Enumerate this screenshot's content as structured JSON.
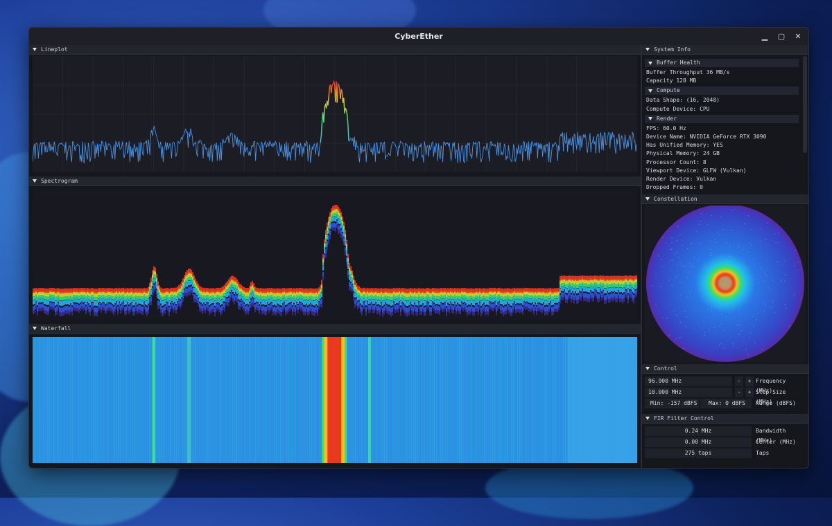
{
  "window": {
    "title": "CyberEther"
  },
  "lineplot": {
    "title": "Lineplot"
  },
  "spectrogram": {
    "title": "Spectrogram"
  },
  "waterfall": {
    "title": "Waterfall"
  },
  "system_info": {
    "title": "System Info",
    "sections": [
      {
        "title": "Buffer Health",
        "lines": [
          "Buffer Throughput 36 MB/s",
          "Capacity 128 MB"
        ]
      },
      {
        "title": "Compute",
        "lines": [
          "Data Shape: (16, 2048)",
          "Compute Device: CPU"
        ]
      },
      {
        "title": "Render",
        "lines": [
          "FPS: 60.0 Hz",
          "Device Name: NVIDIA GeForce RTX 3090",
          "Has Unified Memory: YES",
          "Physical Memory: 24 GB",
          "Processor Count: 8",
          "Viewport Device: GLFW (Vulkan)",
          "Render Device: Vulkan",
          "Dropped Frames: 0"
        ]
      }
    ]
  },
  "constellation": {
    "title": "Constellation"
  },
  "control": {
    "title": "Control",
    "frequency": {
      "value": "96.900 MHz",
      "minus": "-",
      "plus": "+",
      "label": "Frequency (MHz)"
    },
    "step": {
      "value": "10.000 MHz",
      "minus": "-",
      "plus": "+",
      "label": "Step Size (MHz)"
    },
    "range": {
      "min": "Min: -157 dBFS",
      "max": "Max: 0 dBFS",
      "label": "Range (dBFS)"
    }
  },
  "fir": {
    "title": "FIR Filter Control",
    "bandwidth": {
      "value": "0.24 MHz",
      "label": "Bandwidth (MHz)"
    },
    "center": {
      "value": "0.00 MHz",
      "label": "Center (MHz)"
    },
    "taps": {
      "value": "275 taps",
      "label": "Taps"
    }
  },
  "colors": {
    "accent_peak": "#d8302a",
    "trace": "#4aa3e8",
    "waterfall_bg": "#2f8fe0"
  }
}
